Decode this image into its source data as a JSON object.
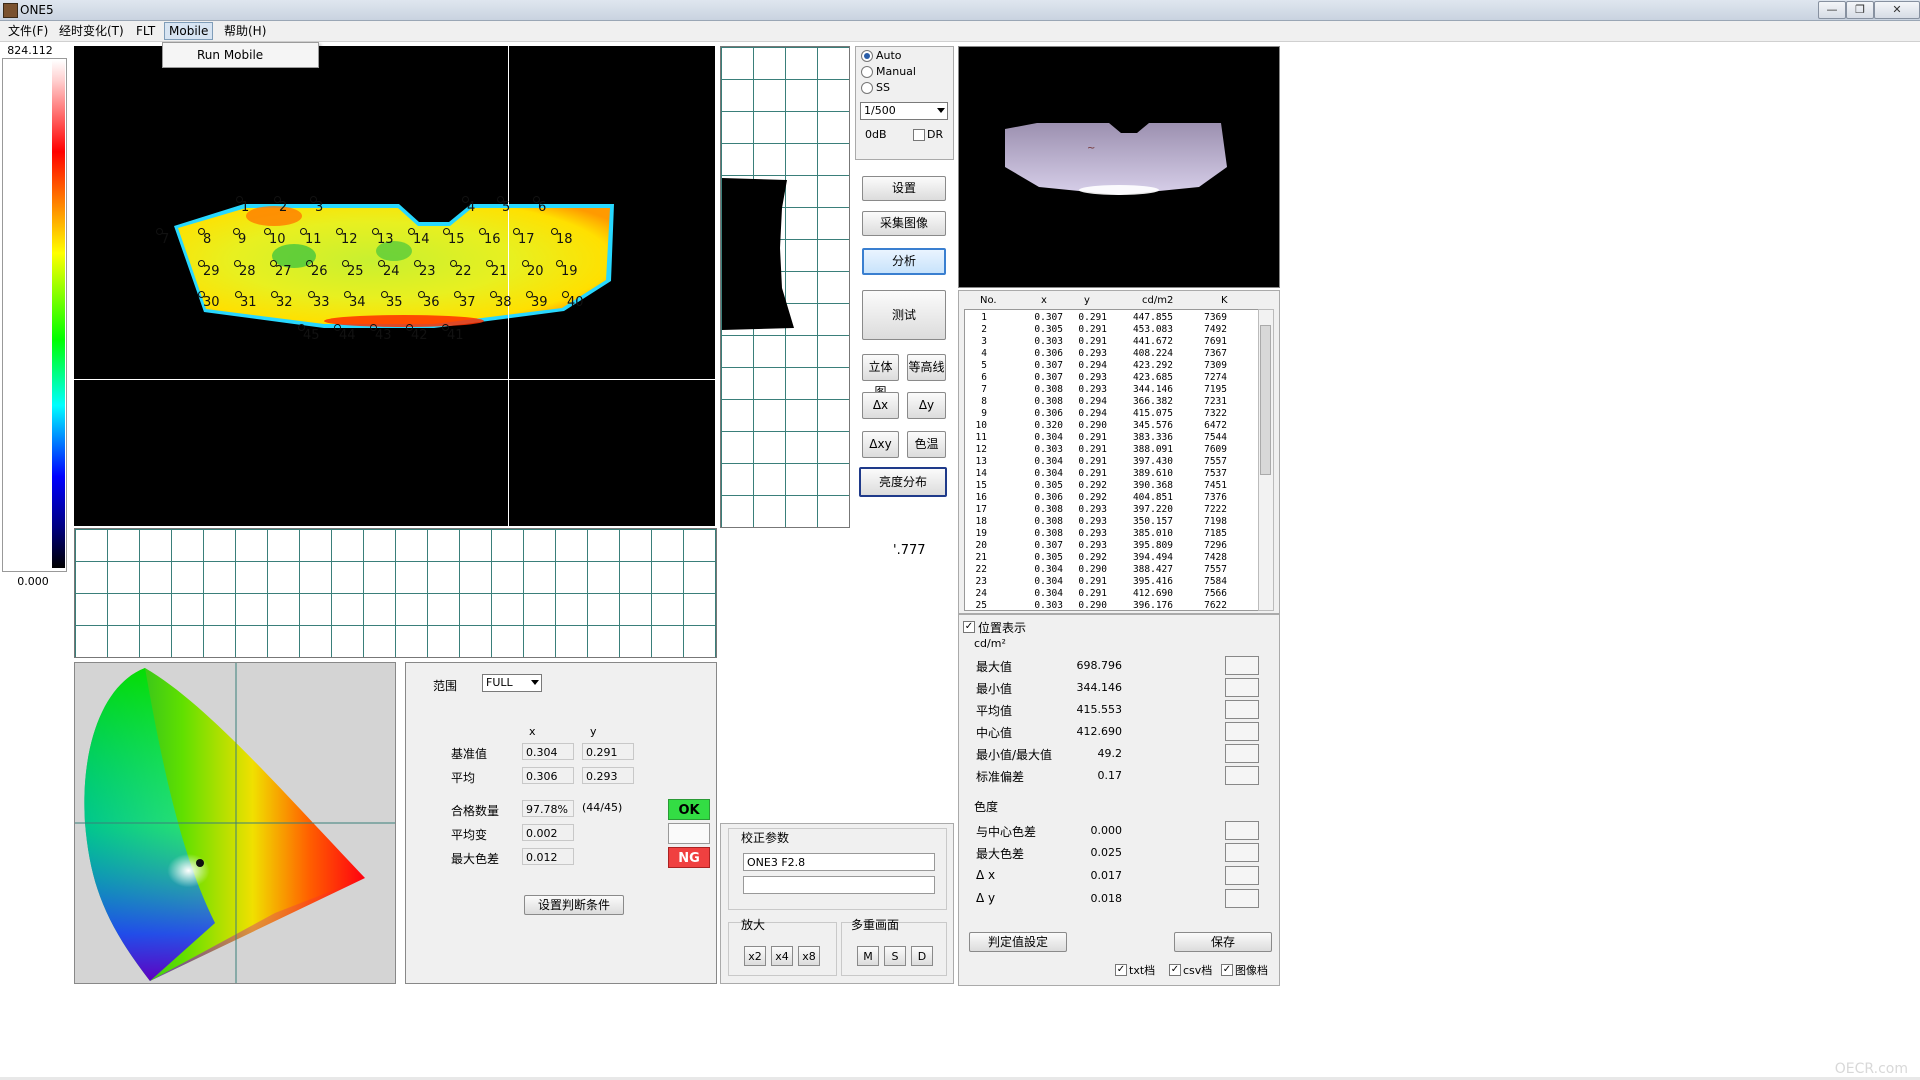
{
  "window": {
    "title": "ONE5",
    "minimize": "—",
    "restore": "❐",
    "close": "✕"
  },
  "menu": {
    "file": "文件(F)",
    "aging": "经时变化(T)",
    "flt": "FLT",
    "mobile": "Mobile",
    "help": "帮助(H)"
  },
  "mobile_menu": {
    "run_mobile": "Run Mobile"
  },
  "scale": {
    "max": "824.112",
    "min": "0.000"
  },
  "camera": {
    "auto": "Auto",
    "manual": "Manual",
    "ss": "SS",
    "shutter": "1/500",
    "gain": "0dB",
    "dr": "DR"
  },
  "buttons": {
    "settings": "设置",
    "capture": "采集图像",
    "analyze": "分析",
    "measure": "测试",
    "stereo": "立体图",
    "contour": "等高线",
    "dx": "Δx",
    "dy": "Δy",
    "dxy": "Δxy",
    "color_temp": "色温",
    "luminance_dist": "亮度分布"
  },
  "grid_value": "'.777",
  "measure_points": [
    {
      "n": "1"
    },
    {
      "n": "2"
    },
    {
      "n": "3"
    },
    {
      "n": "4"
    },
    {
      "n": "5"
    },
    {
      "n": "6"
    },
    {
      "n": "7"
    },
    {
      "n": "8"
    },
    {
      "n": "9"
    },
    {
      "n": "10"
    },
    {
      "n": "11"
    },
    {
      "n": "12"
    },
    {
      "n": "13"
    },
    {
      "n": "14"
    },
    {
      "n": "15"
    },
    {
      "n": "16"
    },
    {
      "n": "17"
    },
    {
      "n": "18"
    },
    {
      "n": "29"
    },
    {
      "n": "28"
    },
    {
      "n": "27"
    },
    {
      "n": "26"
    },
    {
      "n": "25"
    },
    {
      "n": "24"
    },
    {
      "n": "23"
    },
    {
      "n": "22"
    },
    {
      "n": "21"
    },
    {
      "n": "20"
    },
    {
      "n": "19"
    },
    {
      "n": "30"
    },
    {
      "n": "31"
    },
    {
      "n": "32"
    },
    {
      "n": "33"
    },
    {
      "n": "34"
    },
    {
      "n": "35"
    },
    {
      "n": "36"
    },
    {
      "n": "37"
    },
    {
      "n": "38"
    },
    {
      "n": "39"
    },
    {
      "n": "40"
    },
    {
      "n": "45"
    },
    {
      "n": "44"
    },
    {
      "n": "43"
    },
    {
      "n": "42"
    },
    {
      "n": "41"
    }
  ],
  "table": {
    "headers": [
      "No.",
      "x",
      "y",
      "cd/m2",
      "K"
    ],
    "rows": [
      [
        "1",
        "0.307",
        "0.291",
        "447.855",
        "7369"
      ],
      [
        "2",
        "0.305",
        "0.291",
        "453.083",
        "7492"
      ],
      [
        "3",
        "0.303",
        "0.291",
        "441.672",
        "7691"
      ],
      [
        "4",
        "0.306",
        "0.293",
        "408.224",
        "7367"
      ],
      [
        "5",
        "0.307",
        "0.294",
        "423.292",
        "7309"
      ],
      [
        "6",
        "0.307",
        "0.293",
        "423.685",
        "7274"
      ],
      [
        "7",
        "0.308",
        "0.293",
        "344.146",
        "7195"
      ],
      [
        "8",
        "0.308",
        "0.294",
        "366.382",
        "7231"
      ],
      [
        "9",
        "0.306",
        "0.294",
        "415.075",
        "7322"
      ],
      [
        "10",
        "0.320",
        "0.290",
        "345.576",
        "6472"
      ],
      [
        "11",
        "0.304",
        "0.291",
        "383.336",
        "7544"
      ],
      [
        "12",
        "0.303",
        "0.291",
        "388.091",
        "7609"
      ],
      [
        "13",
        "0.304",
        "0.291",
        "397.430",
        "7557"
      ],
      [
        "14",
        "0.304",
        "0.291",
        "389.610",
        "7537"
      ],
      [
        "15",
        "0.305",
        "0.292",
        "390.368",
        "7451"
      ],
      [
        "16",
        "0.306",
        "0.292",
        "404.851",
        "7376"
      ],
      [
        "17",
        "0.308",
        "0.293",
        "397.220",
        "7222"
      ],
      [
        "18",
        "0.308",
        "0.293",
        "350.157",
        "7198"
      ],
      [
        "19",
        "0.308",
        "0.293",
        "385.010",
        "7185"
      ],
      [
        "20",
        "0.307",
        "0.293",
        "395.809",
        "7296"
      ],
      [
        "21",
        "0.305",
        "0.292",
        "394.494",
        "7428"
      ],
      [
        "22",
        "0.304",
        "0.290",
        "388.427",
        "7557"
      ],
      [
        "23",
        "0.304",
        "0.291",
        "395.416",
        "7584"
      ],
      [
        "24",
        "0.304",
        "0.291",
        "412.690",
        "7566"
      ],
      [
        "25",
        "0.303",
        "0.290",
        "396.176",
        "7622"
      ]
    ]
  },
  "stats": {
    "position_display": "位置表示",
    "unit": "cd/m²",
    "max_label": "最大值",
    "max": "698.796",
    "min_label": "最小值",
    "min": "344.146",
    "avg_label": "平均值",
    "avg": "415.553",
    "center_label": "中心值",
    "center": "412.690",
    "ratio_label": "最小值/最大值",
    "ratio": "49.2",
    "std_label": "标准偏差",
    "std": "0.17",
    "chroma_label": "色度",
    "center_diff_label": "与中心色差",
    "center_diff": "0.000",
    "max_diff_label": "最大色差",
    "max_diff": "0.025",
    "dx_label": "Δ x",
    "dx": "0.017",
    "dy_label": "Δ y",
    "dy": "0.018",
    "judge_setting": "判定值設定",
    "save": "保存",
    "txt": "txt档",
    "csv": "csv档",
    "image": "图像档"
  },
  "judgment": {
    "range_label": "范围",
    "range": "FULL",
    "col_x": "x",
    "col_y": "y",
    "ref_label": "基准值",
    "ref_x": "0.304",
    "ref_y": "0.291",
    "avg_label": "平均",
    "avg_x": "0.306",
    "avg_y": "0.293",
    "pass_label": "合格数量",
    "pass_pct": "97.78%",
    "pass_count": "(44/45)",
    "avg_var_label": "平均变",
    "avg_var": "0.002",
    "max_diff_label": "最大色差",
    "max_diff": "0.012",
    "ok": "OK",
    "ng": "NG",
    "set_condition": "设置判断条件"
  },
  "calibration": {
    "title": "校正参数",
    "value": "ONE3 F2.8",
    "zoom_label": "放大",
    "x2": "x2",
    "x4": "x4",
    "x8": "x8",
    "multi_label": "多重画面",
    "m": "M",
    "s": "S",
    "d": "D"
  },
  "watermark": "OECR.com"
}
